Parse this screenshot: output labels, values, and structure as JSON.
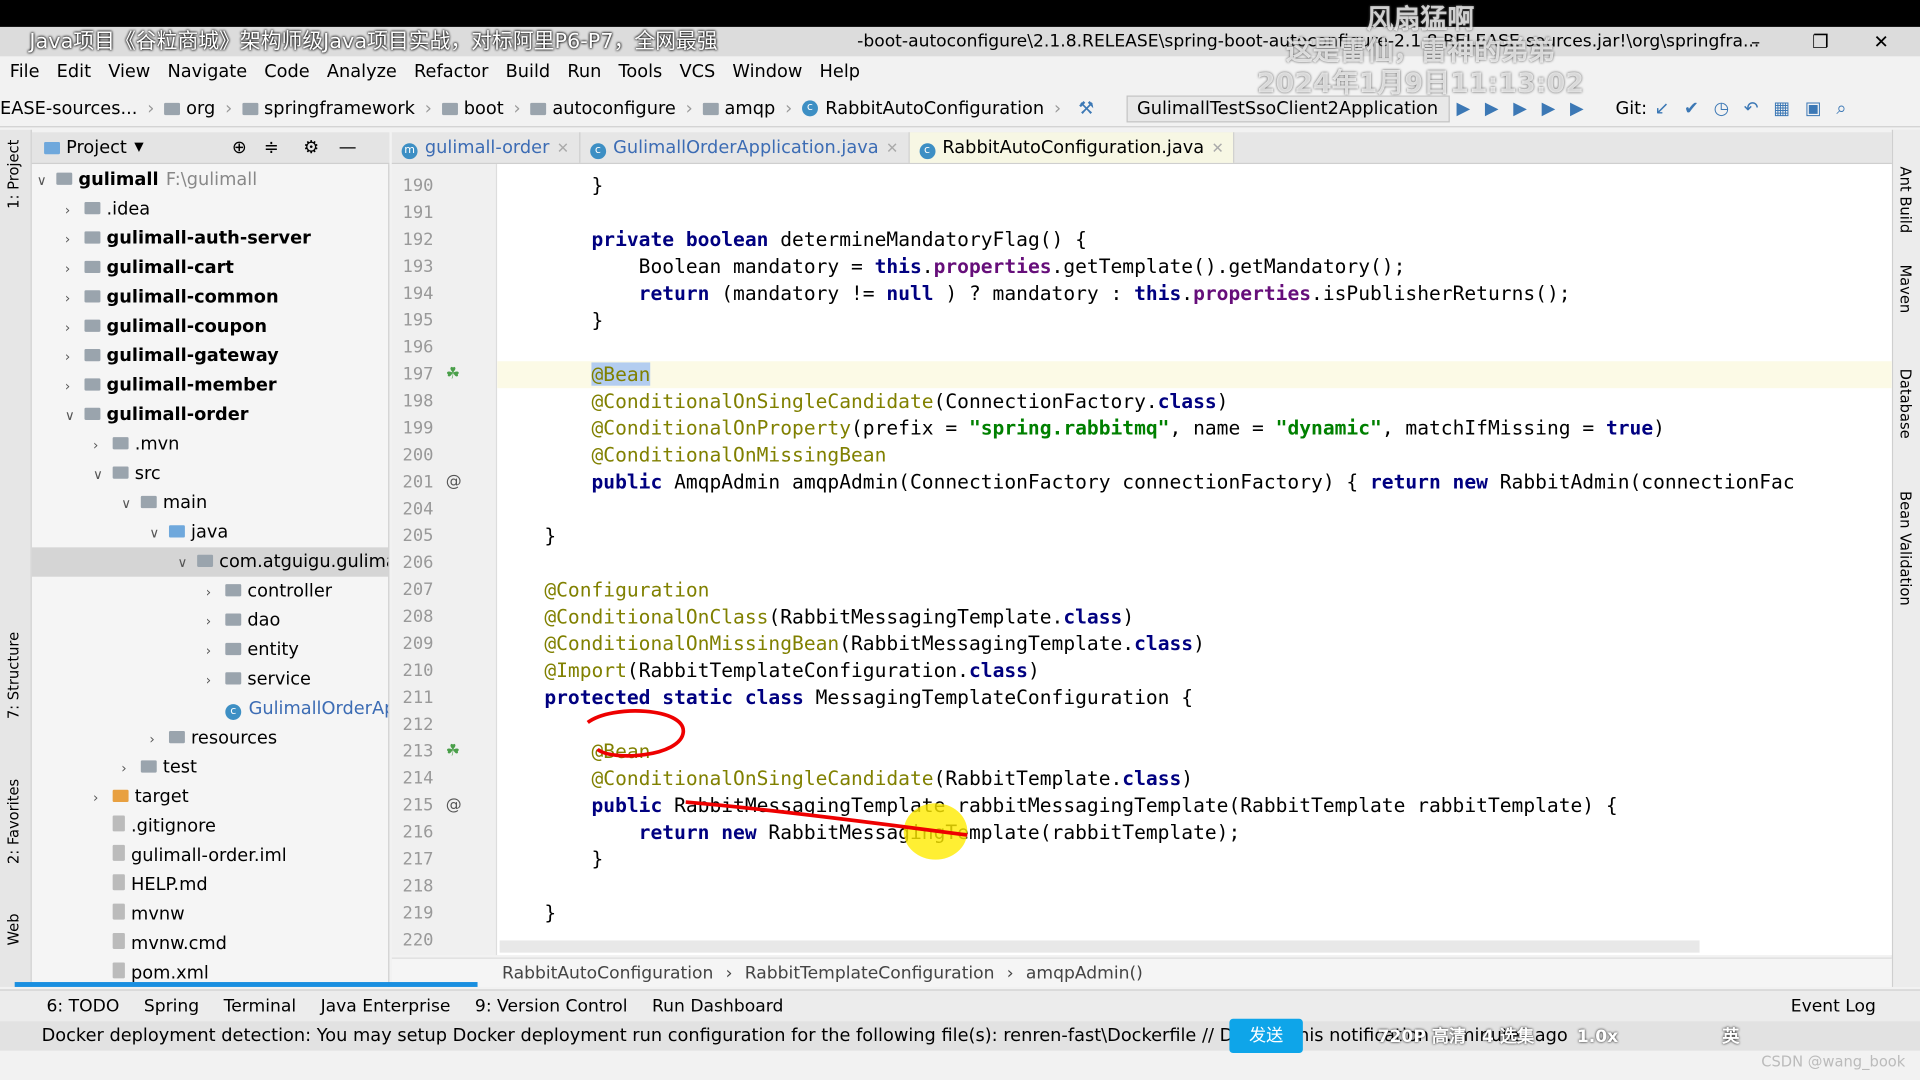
{
  "window": {
    "title": "Java项目《谷粒商城》架构师级Java项目实战，对标阿里P6-P7，全网最强",
    "path": "-boot-autoconfigure\\2.1.8.RELEASE\\spring-boot-autoconfigure-2.1.8.RELEASE-sources.jar!\\org\\springfra...",
    "watermark": [
      "风扇猛啊",
      "这是雷仙，雷神的弟弟",
      "2024年1月9日11:13:02"
    ]
  },
  "menu": [
    "File",
    "Edit",
    "View",
    "Navigate",
    "Code",
    "Analyze",
    "Refactor",
    "Build",
    "Run",
    "Tools",
    "VCS",
    "Window",
    "Help"
  ],
  "nav": {
    "crumbs": [
      "EASE-sources...",
      "org",
      "springframework",
      "boot",
      "autoconfigure",
      "amqp"
    ],
    "file": "RabbitAutoConfiguration",
    "run_config": "GulimallTestSsoClient2Application",
    "git": "Git:"
  },
  "project": {
    "title": "Project",
    "tree": [
      {
        "label": "gulimall",
        "extra": "F:\\gulimall",
        "level": 0,
        "arrow": "open",
        "bold": true
      },
      {
        "label": ".idea",
        "level": 1,
        "arrow": "closed"
      },
      {
        "label": "gulimall-auth-server",
        "level": 1,
        "arrow": "closed",
        "bold": true
      },
      {
        "label": "gulimall-cart",
        "level": 1,
        "arrow": "closed",
        "bold": true
      },
      {
        "label": "gulimall-common",
        "level": 1,
        "arrow": "closed",
        "bold": true
      },
      {
        "label": "gulimall-coupon",
        "level": 1,
        "arrow": "closed",
        "bold": true
      },
      {
        "label": "gulimall-gateway",
        "level": 1,
        "arrow": "closed",
        "bold": true
      },
      {
        "label": "gulimall-member",
        "level": 1,
        "arrow": "closed",
        "bold": true
      },
      {
        "label": "gulimall-order",
        "level": 1,
        "arrow": "open",
        "bold": true
      },
      {
        "label": ".mvn",
        "level": 2,
        "arrow": "closed"
      },
      {
        "label": "src",
        "level": 2,
        "arrow": "open"
      },
      {
        "label": "main",
        "level": 3,
        "arrow": "open"
      },
      {
        "label": "java",
        "level": 4,
        "arrow": "open"
      },
      {
        "label": "com.atguigu.gulima",
        "level": 5,
        "arrow": "open",
        "selected": true
      },
      {
        "label": "controller",
        "level": 6,
        "arrow": "closed"
      },
      {
        "label": "dao",
        "level": 6,
        "arrow": "closed"
      },
      {
        "label": "entity",
        "level": 6,
        "arrow": "closed"
      },
      {
        "label": "service",
        "level": 6,
        "arrow": "closed"
      },
      {
        "label": "GulimallOrderAp",
        "level": 6,
        "arrow": "none",
        "class": true
      },
      {
        "label": "resources",
        "level": 4,
        "arrow": "closed"
      },
      {
        "label": "test",
        "level": 3,
        "arrow": "closed"
      },
      {
        "label": "target",
        "level": 2,
        "arrow": "closed",
        "target": true
      },
      {
        "label": ".gitignore",
        "level": 2,
        "arrow": "none",
        "file": true
      },
      {
        "label": "gulimall-order.iml",
        "level": 2,
        "arrow": "none",
        "file": true
      },
      {
        "label": "HELP.md",
        "level": 2,
        "arrow": "none",
        "file": true
      },
      {
        "label": "mvnw",
        "level": 2,
        "arrow": "none",
        "file": true
      },
      {
        "label": "mvnw.cmd",
        "level": 2,
        "arrow": "none",
        "file": true
      },
      {
        "label": "pom.xml",
        "level": 2,
        "arrow": "none",
        "file": true
      }
    ]
  },
  "tabs": [
    {
      "label": "gulimall-order"
    },
    {
      "label": "GulimallOrderApplication.java"
    },
    {
      "label": "RabbitAutoConfiguration.java",
      "active": true
    }
  ],
  "code": [
    {
      "n": "190",
      "t": [
        [
          "",
          "        }"
        ]
      ]
    },
    {
      "n": "191",
      "t": []
    },
    {
      "n": "192",
      "t": [
        [
          "",
          "        "
        ],
        [
          "kw",
          "private boolean"
        ],
        [
          "",
          " determineMandatoryFlag() {"
        ]
      ]
    },
    {
      "n": "193",
      "t": [
        [
          "",
          "            Boolean mandatory = "
        ],
        [
          "kw",
          "this"
        ],
        [
          "",
          "."
        ],
        [
          "fd",
          "properties"
        ],
        [
          "",
          ".getTemplate().getMandatory();"
        ]
      ]
    },
    {
      "n": "194",
      "t": [
        [
          "",
          "            "
        ],
        [
          "kw",
          "return"
        ],
        [
          "",
          " (mandatory != "
        ],
        [
          "kw",
          "null"
        ],
        [
          "",
          " ) ? mandatory : "
        ],
        [
          "kw",
          "this"
        ],
        [
          "",
          "."
        ],
        [
          "fd",
          "properties"
        ],
        [
          "",
          ".isPublisherReturns();"
        ]
      ]
    },
    {
      "n": "195",
      "t": [
        [
          "",
          "        }"
        ]
      ]
    },
    {
      "n": "196",
      "t": []
    },
    {
      "n": "197",
      "cur": true,
      "t": [
        [
          "",
          "        "
        ],
        [
          "an hl",
          "@Bean"
        ]
      ]
    },
    {
      "n": "198",
      "t": [
        [
          "",
          "        "
        ],
        [
          "an",
          "@ConditionalOnSingleCandidate"
        ],
        [
          "",
          "(ConnectionFactory."
        ],
        [
          "kw",
          "class"
        ],
        [
          "",
          ")"
        ]
      ]
    },
    {
      "n": "199",
      "t": [
        [
          "",
          "        "
        ],
        [
          "an",
          "@ConditionalOnProperty"
        ],
        [
          "",
          "(prefix = "
        ],
        [
          "st",
          "\"spring.rabbitmq\""
        ],
        [
          "",
          ", name = "
        ],
        [
          "st",
          "\"dynamic\""
        ],
        [
          "",
          ", matchIfMissing = "
        ],
        [
          "kw",
          "true"
        ],
        [
          "",
          ")"
        ]
      ]
    },
    {
      "n": "200",
      "t": [
        [
          "",
          "        "
        ],
        [
          "an",
          "@ConditionalOnMissingBean"
        ]
      ]
    },
    {
      "n": "201",
      "t": [
        [
          "",
          "        "
        ],
        [
          "kw",
          "public"
        ],
        [
          "",
          " AmqpAdmin amqpAdmin(ConnectionFactory connectionFactory) { "
        ],
        [
          "kw",
          "return new"
        ],
        [
          "",
          " RabbitAdmin(connectionFac"
        ]
      ]
    },
    {
      "n": "204",
      "t": []
    },
    {
      "n": "205",
      "t": [
        [
          "",
          "    }"
        ]
      ]
    },
    {
      "n": "206",
      "t": []
    },
    {
      "n": "207",
      "t": [
        [
          "",
          "    "
        ],
        [
          "an",
          "@Configuration"
        ]
      ]
    },
    {
      "n": "208",
      "t": [
        [
          "",
          "    "
        ],
        [
          "an",
          "@ConditionalOnClass"
        ],
        [
          "",
          "(RabbitMessagingTemplate."
        ],
        [
          "kw",
          "class"
        ],
        [
          "",
          ")"
        ]
      ]
    },
    {
      "n": "209",
      "t": [
        [
          "",
          "    "
        ],
        [
          "an",
          "@ConditionalOnMissingBean"
        ],
        [
          "",
          "(RabbitMessagingTemplate."
        ],
        [
          "kw",
          "class"
        ],
        [
          "",
          ")"
        ]
      ]
    },
    {
      "n": "210",
      "t": [
        [
          "",
          "    "
        ],
        [
          "an",
          "@Import"
        ],
        [
          "",
          "(RabbitTemplateConfiguration."
        ],
        [
          "kw",
          "class"
        ],
        [
          "",
          ")"
        ]
      ]
    },
    {
      "n": "211",
      "t": [
        [
          "",
          "    "
        ],
        [
          "kw",
          "protected static class"
        ],
        [
          "",
          " MessagingTemplateConfiguration {"
        ]
      ]
    },
    {
      "n": "212",
      "t": []
    },
    {
      "n": "213",
      "t": [
        [
          "",
          "        "
        ],
        [
          "an",
          "@Bean"
        ]
      ]
    },
    {
      "n": "214",
      "t": [
        [
          "",
          "        "
        ],
        [
          "an",
          "@ConditionalOnSingleCandidate"
        ],
        [
          "",
          "(RabbitTemplate."
        ],
        [
          "kw",
          "class"
        ],
        [
          "",
          ")"
        ]
      ]
    },
    {
      "n": "215",
      "t": [
        [
          "",
          "        "
        ],
        [
          "kw",
          "public"
        ],
        [
          "",
          " RabbitMessagingTemplate rabbitMessagingTemplate(RabbitTemplate rabbitTemplate) {"
        ]
      ]
    },
    {
      "n": "216",
      "t": [
        [
          "",
          "            "
        ],
        [
          "kw",
          "return new"
        ],
        [
          "",
          " RabbitMessagingTemplate(rabbitTemplate);"
        ]
      ]
    },
    {
      "n": "217",
      "t": [
        [
          "",
          "        }"
        ]
      ]
    },
    {
      "n": "218",
      "t": []
    },
    {
      "n": "219",
      "t": [
        [
          "",
          "    }"
        ]
      ]
    },
    {
      "n": "220",
      "t": []
    }
  ],
  "editor_breadcrumb": [
    "RabbitAutoConfiguration",
    "RabbitTemplateConfiguration",
    "amqpAdmin()"
  ],
  "toolwindows": [
    "6: TODO",
    "Spring",
    "Terminal",
    "Java Enterprise",
    "9: Version Control",
    "Run Dashboard"
  ],
  "event_log": "Event Log",
  "status": {
    "text": "Docker deployment detection: You may setup Docker deployment run configuration for the following file(s): renren-fast\\Dockerfile // Disable this notification ... minutes ago",
    "send": "发送",
    "quality": "720P 高清",
    "episodes": "4 选集",
    "speed": "1.0x",
    "ime": "英"
  },
  "right_strip": [
    "Ant Build",
    "Maven",
    "Database",
    "Bean Validation"
  ],
  "left_strip": [
    "1: Project",
    "7: Structure",
    "2: Favorites",
    "Web"
  ],
  "credit": "CSDN @wang_book"
}
